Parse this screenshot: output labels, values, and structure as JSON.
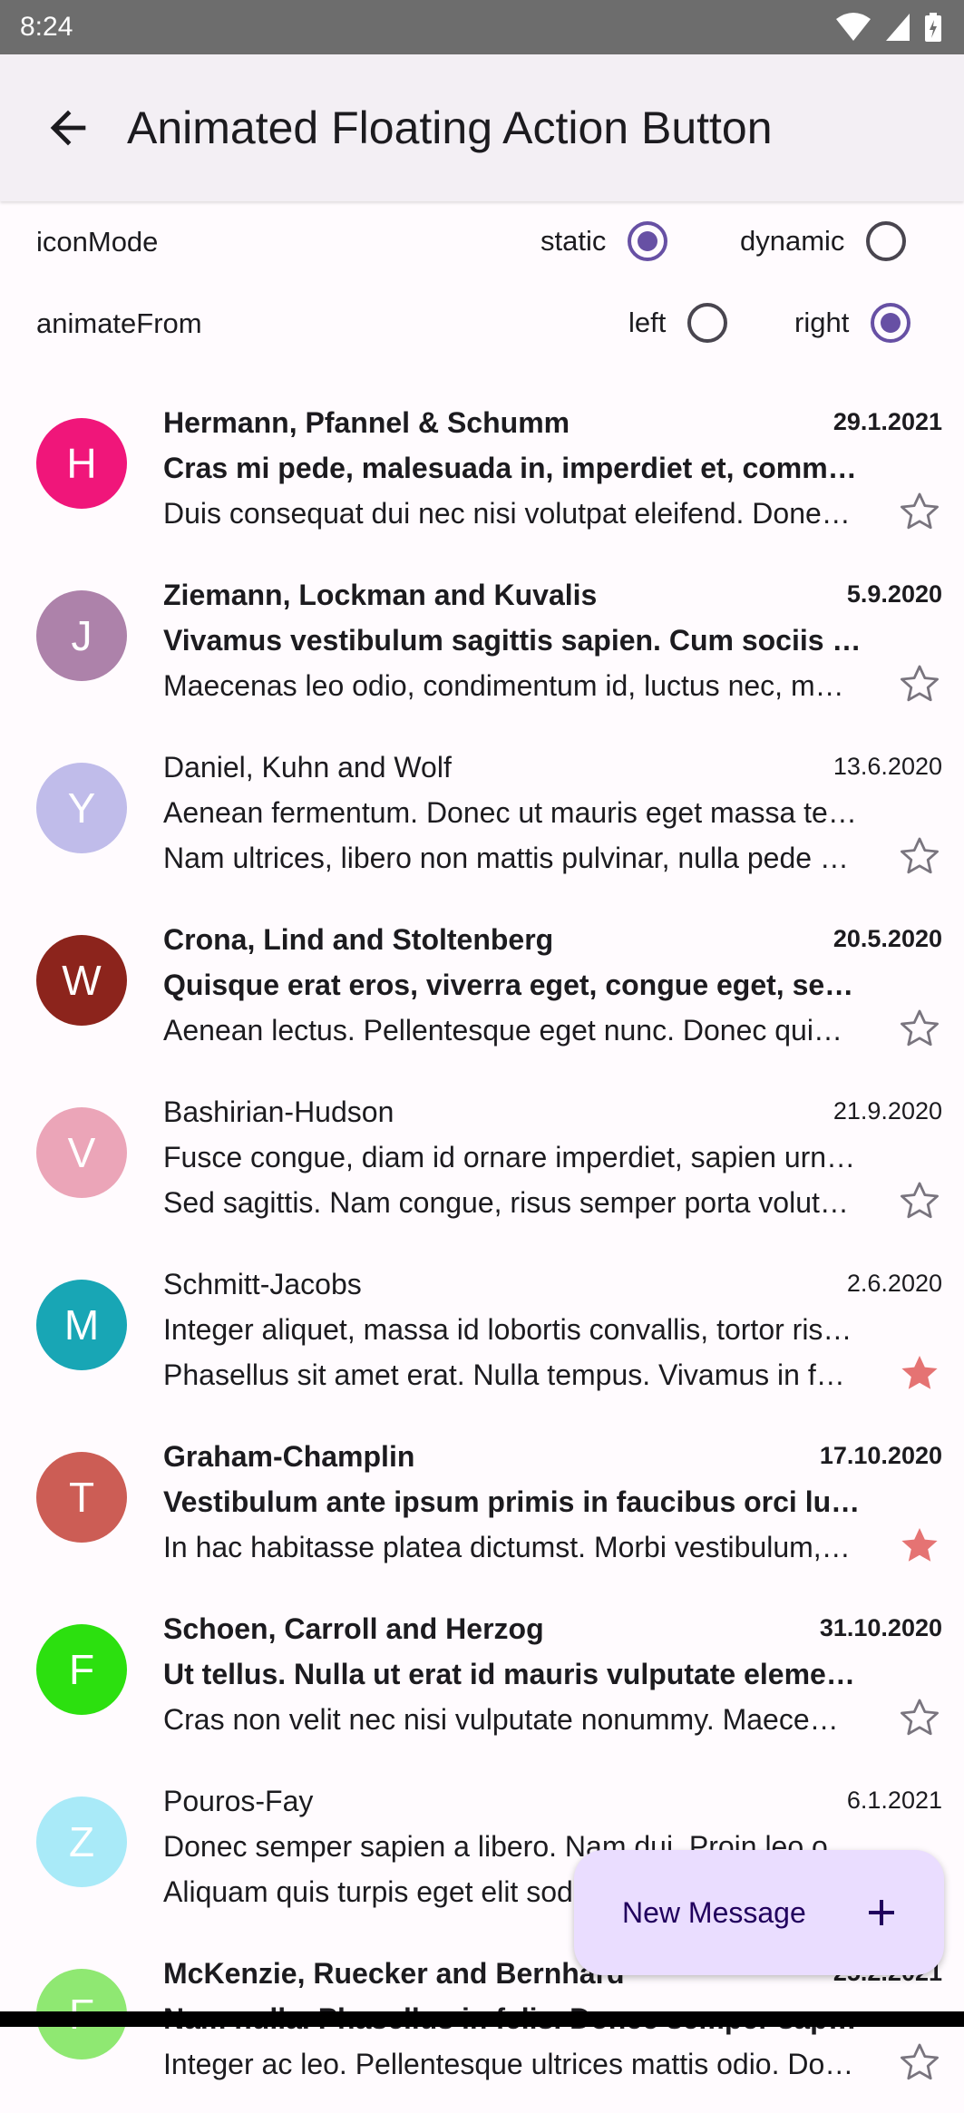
{
  "status_bar": {
    "time": "8:24"
  },
  "app_bar": {
    "title": "Animated Floating Action Button"
  },
  "options": {
    "icon_mode": {
      "label": "iconMode",
      "choices": [
        {
          "label": "static",
          "selected": true
        },
        {
          "label": "dynamic",
          "selected": false
        }
      ]
    },
    "animate_from": {
      "label": "animateFrom",
      "choices": [
        {
          "label": "left",
          "selected": false
        },
        {
          "label": "right",
          "selected": true
        }
      ]
    }
  },
  "messages": [
    {
      "initial": "H",
      "color": "#f0167a",
      "sender": "Hermann, Pfannel & Schumm",
      "date": "29.1.2021",
      "subject": "Cras mi pede, malesuada in, imperdiet et, commodo vulputate",
      "snippet": "Duis consequat dui nec nisi volutpat eleifend. Donec ut dolor",
      "unread": true,
      "starred": false
    },
    {
      "initial": "J",
      "color": "#ad82aa",
      "sender": "Ziemann, Lockman and Kuvalis",
      "date": "5.9.2020",
      "subject": "Vivamus vestibulum sagittis sapien. Cum sociis natoque",
      "snippet": "Maecenas leo odio, condimentum id, luctus nec, molestie sed",
      "unread": true,
      "starred": false
    },
    {
      "initial": "Y",
      "color": "#c0bcea",
      "sender": "Daniel, Kuhn and Wolf",
      "date": "13.6.2020",
      "subject": "Aenean fermentum. Donec ut mauris eget massa tempor convallis",
      "snippet": "Nam ultrices, libero non mattis pulvinar, nulla pede ullamcorper",
      "unread": false,
      "starred": false
    },
    {
      "initial": "W",
      "color": "#8c241c",
      "sender": "Crona, Lind and Stoltenberg",
      "date": "20.5.2020",
      "subject": "Quisque erat eros, viverra eget, congue eget, semper rutrum",
      "snippet": "Aenean lectus. Pellentesque eget nunc. Donec quis orci eget",
      "unread": true,
      "starred": false
    },
    {
      "initial": "V",
      "color": "#eba5b8",
      "sender": "Bashirian-Hudson",
      "date": "21.9.2020",
      "subject": "Fusce congue, diam id ornare imperdiet, sapien urna pretium",
      "snippet": "Sed sagittis. Nam congue, risus semper porta volutpat, quam pede",
      "unread": false,
      "starred": false
    },
    {
      "initial": "M",
      "color": "#18a6b5",
      "sender": "Schmitt-Jacobs",
      "date": "2.6.2020",
      "subject": "Integer aliquet, massa id lobortis convallis, tortor risus dapibus",
      "snippet": "Phasellus sit amet erat. Nulla tempus. Vivamus in felis eu",
      "unread": false,
      "starred": true
    },
    {
      "initial": "T",
      "color": "#cc5d55",
      "sender": "Graham-Champlin",
      "date": "17.10.2020",
      "subject": "Vestibulum ante ipsum primis in faucibus orci luctus et ultrices",
      "snippet": "In hac habitasse platea dictumst. Morbi vestibulum, velit id pretium",
      "unread": true,
      "starred": true
    },
    {
      "initial": "F",
      "color": "#2ce00f",
      "sender": "Schoen, Carroll and Herzog",
      "date": "31.10.2020",
      "subject": "Ut tellus. Nulla ut erat id mauris vulputate elementum. Nullam",
      "snippet": "Cras non velit nec nisi vulputate nonummy. Maecenas tincidunt",
      "unread": true,
      "starred": false
    },
    {
      "initial": "Z",
      "color": "#a9eaf8",
      "sender": "Pouros-Fay",
      "date": "6.1.2021",
      "subject": "Donec semper sapien a libero. Nam dui. Proin leo odio, porttitor",
      "snippet": "Aliquam quis turpis eget elit sodales scelerisque. Mauris sit amet",
      "unread": false,
      "starred": false
    },
    {
      "initial": "F",
      "color": "#8fe872",
      "sender": "McKenzie, Ruecker and Bernhard",
      "date": "25.2.2021",
      "subject": "Nam nulla. Phasellus in felis. Donec semper sapien a libero",
      "snippet": "Integer ac leo. Pellentesque ultrices mattis odio. Donec vitae nisi",
      "unread": true,
      "starred": false
    }
  ],
  "fab": {
    "label": "New Message",
    "icon": "plus-icon"
  },
  "colors": {
    "accent": "#6750a4",
    "star_on": "#e57373",
    "star_off": "#79747e",
    "fab_bg": "#eaddff"
  }
}
